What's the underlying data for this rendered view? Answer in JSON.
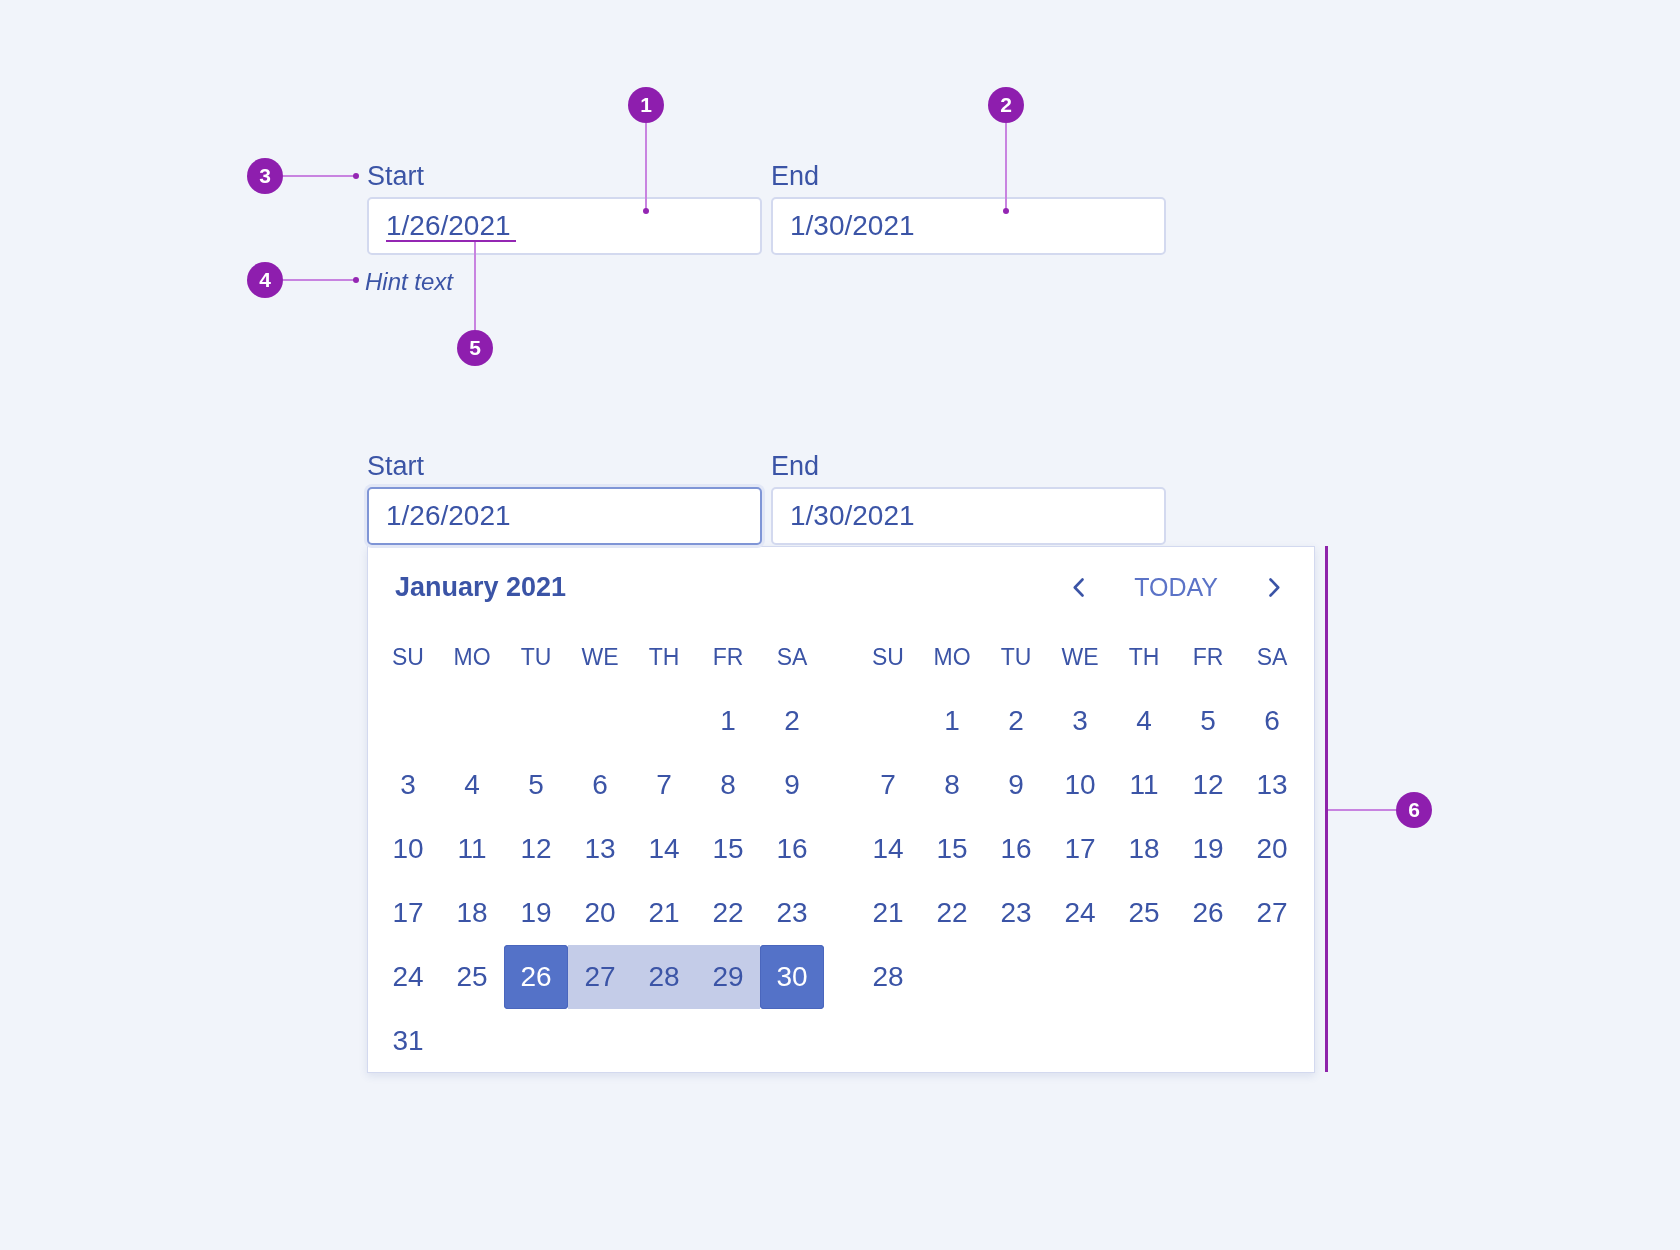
{
  "annotations": [
    {
      "number": "1"
    },
    {
      "number": "2"
    },
    {
      "number": "3"
    },
    {
      "number": "4"
    },
    {
      "number": "5"
    },
    {
      "number": "6"
    }
  ],
  "anatomy_example": {
    "start": {
      "label": "Start",
      "value": "1/26/2021",
      "focused": false,
      "hint": "Hint text"
    },
    "end": {
      "label": "End",
      "value": "1/30/2021",
      "focused": false
    }
  },
  "open_example": {
    "start": {
      "label": "Start",
      "value": "1/26/2021",
      "focused": true
    },
    "end": {
      "label": "End",
      "value": "1/30/2021",
      "focused": false
    },
    "calendar": {
      "title": "January 2021",
      "today_button": "TODAY",
      "months": [
        {
          "weekdays": [
            "SU",
            "MO",
            "TU",
            "WE",
            "TH",
            "FR",
            "SA"
          ],
          "weeks": [
            [
              {
                "day": "1",
                "selected": false,
                "in_range": false
              },
              {
                "day": "2",
                "selected": false,
                "in_range": false
              }
            ],
            [
              {
                "day": "3",
                "selected": false,
                "in_range": false
              },
              {
                "day": "4",
                "selected": false,
                "in_range": false
              },
              {
                "day": "5",
                "selected": false,
                "in_range": false
              },
              {
                "day": "6",
                "selected": false,
                "in_range": false
              },
              {
                "day": "7",
                "selected": false,
                "in_range": false
              },
              {
                "day": "8",
                "selected": false,
                "in_range": false
              },
              {
                "day": "9",
                "selected": false,
                "in_range": false
              }
            ],
            [
              {
                "day": "10",
                "selected": false,
                "in_range": false
              },
              {
                "day": "11",
                "selected": false,
                "in_range": false
              },
              {
                "day": "12",
                "selected": false,
                "in_range": false
              },
              {
                "day": "13",
                "selected": false,
                "in_range": false
              },
              {
                "day": "14",
                "selected": false,
                "in_range": false
              },
              {
                "day": "15",
                "selected": false,
                "in_range": false
              },
              {
                "day": "16",
                "selected": false,
                "in_range": false
              }
            ],
            [
              {
                "day": "17",
                "selected": false,
                "in_range": false
              },
              {
                "day": "18",
                "selected": false,
                "in_range": false
              },
              {
                "day": "19",
                "selected": false,
                "in_range": false
              },
              {
                "day": "20",
                "selected": false,
                "in_range": false
              },
              {
                "day": "21",
                "selected": false,
                "in_range": false
              },
              {
                "day": "22",
                "selected": false,
                "in_range": false
              },
              {
                "day": "23",
                "selected": false,
                "in_range": false
              }
            ],
            [
              {
                "day": "24",
                "selected": false,
                "in_range": false
              },
              {
                "day": "25",
                "selected": false,
                "in_range": false
              },
              {
                "day": "26",
                "selected": true,
                "in_range": false
              },
              {
                "day": "27",
                "selected": false,
                "in_range": true
              },
              {
                "day": "28",
                "selected": false,
                "in_range": true
              },
              {
                "day": "29",
                "selected": false,
                "in_range": true
              },
              {
                "day": "30",
                "selected": true,
                "in_range": false
              }
            ],
            [
              {
                "day": "31",
                "selected": false,
                "in_range": false
              }
            ]
          ]
        },
        {
          "weekdays": [
            "SU",
            "MO",
            "TU",
            "WE",
            "TH",
            "FR",
            "SA"
          ],
          "weeks": [
            [
              {
                "day": "1",
                "selected": false,
                "in_range": false
              },
              {
                "day": "2",
                "selected": false,
                "in_range": false
              },
              {
                "day": "3",
                "selected": false,
                "in_range": false
              },
              {
                "day": "4",
                "selected": false,
                "in_range": false
              },
              {
                "day": "5",
                "selected": false,
                "in_range": false
              },
              {
                "day": "6",
                "selected": false,
                "in_range": false
              }
            ],
            [
              {
                "day": "7",
                "selected": false,
                "in_range": false
              },
              {
                "day": "8",
                "selected": false,
                "in_range": false
              },
              {
                "day": "9",
                "selected": false,
                "in_range": false
              },
              {
                "day": "10",
                "selected": false,
                "in_range": false
              },
              {
                "day": "11",
                "selected": false,
                "in_range": false
              },
              {
                "day": "12",
                "selected": false,
                "in_range": false
              },
              {
                "day": "13",
                "selected": false,
                "in_range": false
              }
            ],
            [
              {
                "day": "14",
                "selected": false,
                "in_range": false
              },
              {
                "day": "15",
                "selected": false,
                "in_range": false
              },
              {
                "day": "16",
                "selected": false,
                "in_range": false
              },
              {
                "day": "17",
                "selected": false,
                "in_range": false
              },
              {
                "day": "18",
                "selected": false,
                "in_range": false
              },
              {
                "day": "19",
                "selected": false,
                "in_range": false
              },
              {
                "day": "20",
                "selected": false,
                "in_range": false
              }
            ],
            [
              {
                "day": "21",
                "selected": false,
                "in_range": false
              },
              {
                "day": "22",
                "selected": false,
                "in_range": false
              },
              {
                "day": "23",
                "selected": false,
                "in_range": false
              },
              {
                "day": "24",
                "selected": false,
                "in_range": false
              },
              {
                "day": "25",
                "selected": false,
                "in_range": false
              },
              {
                "day": "26",
                "selected": false,
                "in_range": false
              },
              {
                "day": "27",
                "selected": false,
                "in_range": false
              }
            ],
            [
              {
                "day": "28",
                "selected": false,
                "in_range": false
              }
            ]
          ]
        }
      ]
    }
  }
}
